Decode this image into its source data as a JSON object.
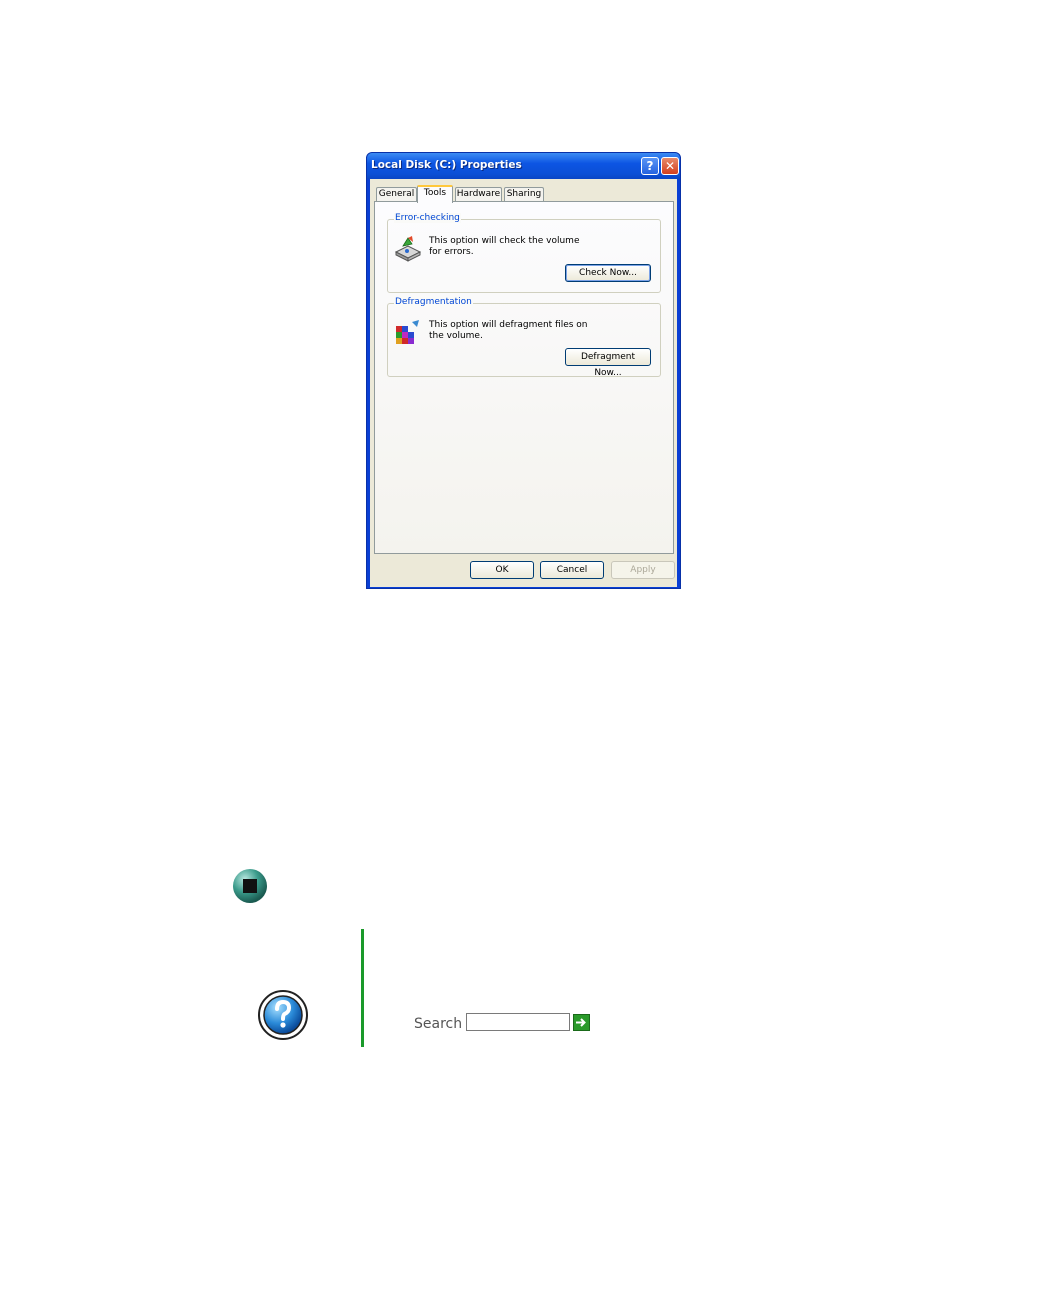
{
  "dialog": {
    "title": "Local Disk (C:) Properties",
    "help_button": "?",
    "close_button": "✕",
    "tabs": [
      {
        "label": "General",
        "active": false
      },
      {
        "label": "Tools",
        "active": true
      },
      {
        "label": "Hardware",
        "active": false
      },
      {
        "label": "Sharing",
        "active": false
      }
    ],
    "error_checking": {
      "legend": "Error-checking",
      "description": "This option will check the volume for errors.",
      "button": "Check Now..."
    },
    "defragmentation": {
      "legend": "Defragmentation",
      "description": "This option will defragment files on the volume.",
      "button": "Defragment Now..."
    },
    "footer": {
      "ok": "OK",
      "cancel": "Cancel",
      "apply": "Apply"
    }
  },
  "help_box": {
    "search_label": "Search",
    "search_value": "",
    "icons": [
      "stop-icon",
      "help-icon",
      "go-arrow-icon"
    ]
  },
  "colors": {
    "accent_green": "#1a9a2a",
    "titlebar_blue": "#0d55e3",
    "legend_blue": "#0046d5"
  }
}
